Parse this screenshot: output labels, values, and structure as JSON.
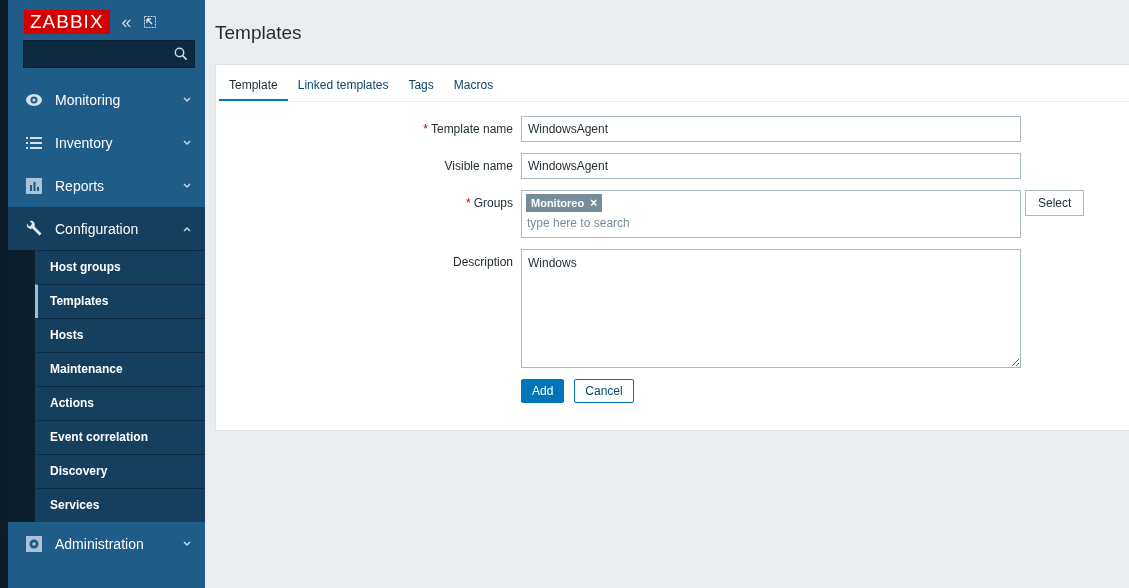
{
  "sidebar": {
    "logo": "ZABBIX",
    "collapse_glyph": "«",
    "menu": [
      {
        "label": "Monitoring",
        "expanded": false
      },
      {
        "label": "Inventory",
        "expanded": false
      },
      {
        "label": "Reports",
        "expanded": false
      },
      {
        "label": "Configuration",
        "expanded": true,
        "children": [
          {
            "label": "Host groups",
            "selected": false
          },
          {
            "label": "Templates",
            "selected": true
          },
          {
            "label": "Hosts",
            "selected": false
          },
          {
            "label": "Maintenance",
            "selected": false
          },
          {
            "label": "Actions",
            "selected": false
          },
          {
            "label": "Event correlation",
            "selected": false
          },
          {
            "label": "Discovery",
            "selected": false
          },
          {
            "label": "Services",
            "selected": false
          }
        ]
      },
      {
        "label": "Administration",
        "expanded": false
      }
    ]
  },
  "page": {
    "title": "Templates"
  },
  "tabs": [
    {
      "label": "Template",
      "selected": true
    },
    {
      "label": "Linked templates",
      "selected": false
    },
    {
      "label": "Tags",
      "selected": false
    },
    {
      "label": "Macros",
      "selected": false
    }
  ],
  "form": {
    "fields": [
      {
        "kind": "text",
        "label": "Template name",
        "required_mark": "*",
        "value": "WindowsAgent"
      },
      {
        "kind": "text",
        "label": "Visible name",
        "value": "WindowsAgent"
      },
      {
        "kind": "multiselect",
        "label": "Groups",
        "required_mark": "*",
        "tags": [
          {
            "label": "Monitoreo",
            "remove": "×"
          }
        ],
        "placeholder": "type here to search",
        "button": "Select"
      },
      {
        "kind": "textarea",
        "label": "Description",
        "value": "Windows"
      }
    ],
    "buttons": [
      {
        "label": "Add",
        "primary": true
      },
      {
        "label": "Cancel",
        "primary": false
      }
    ]
  }
}
